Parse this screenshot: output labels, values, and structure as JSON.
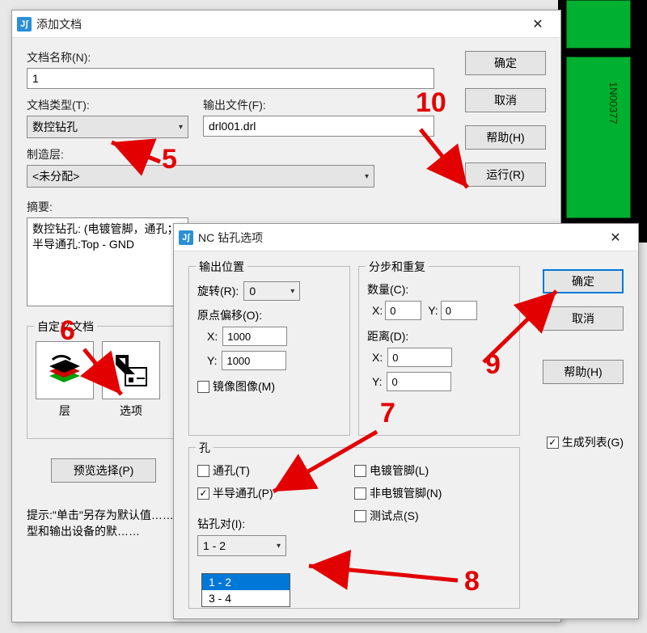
{
  "dialog1": {
    "title": "添加文档",
    "docName": {
      "label": "文档名称(N):",
      "value": "1"
    },
    "docType": {
      "label": "文档类型(T):",
      "value": "数控钻孔"
    },
    "outputFile": {
      "label": "输出文件(F):",
      "value": "drl001.drl"
    },
    "fabLayer": {
      "label": "制造层:",
      "value": "<未分配>"
    },
    "summary": {
      "label": "摘要:",
      "value": "数控钻孔: (电镀管脚，通孔；\n半导通孔:Top - GND"
    },
    "customGroup": {
      "legend": "自定义文档",
      "layer": "层",
      "options": "选项"
    },
    "previewBtn": "预览选择(P)",
    "hint": "提示:\"单击\"另存为默认值……\n        型和输出设备的默……",
    "buttons": {
      "ok": "确定",
      "cancel": "取消",
      "help": "帮助(H)",
      "run": "运行(R)"
    }
  },
  "dialog2": {
    "title": "NC 钻孔选项",
    "outputPos": {
      "legend": "输出位置",
      "rotationLabel": "旋转(R):",
      "rotationValue": "0",
      "originLabel": "原点偏移(O):",
      "x": "1000",
      "y": "1000",
      "xLabel": "X:",
      "yLabel": "Y:",
      "mirrorLabel": "镜像图像(M)"
    },
    "stepRepeat": {
      "legend": "分步和重复",
      "countLabel": "数量(C):",
      "countX": "0",
      "countY": "0",
      "distLabel": "距离(D):",
      "distX": "0",
      "distY": "0",
      "xLabel": "X:",
      "yLabel": "Y:"
    },
    "holes": {
      "legend": "孔",
      "through": "通孔(T)",
      "partial": "半导通孔(P)",
      "plated": "电镀管脚(L)",
      "nonplated": "非电镀管脚(N)",
      "testpoint": "测试点(S)",
      "drillPairLabel": "钻孔对(I):",
      "drillPairValue": "1 - 2",
      "drillPairOpts": [
        "1 - 2",
        "3 - 4"
      ]
    },
    "genList": "生成列表(G)",
    "buttons": {
      "ok": "确定",
      "cancel": "取消",
      "help": "帮助(H)"
    }
  },
  "annotations": {
    "n5": "5",
    "n6": "6",
    "n7": "7",
    "n8": "8",
    "n9": "9",
    "n10": "10"
  },
  "pcb_label": "1N00377"
}
